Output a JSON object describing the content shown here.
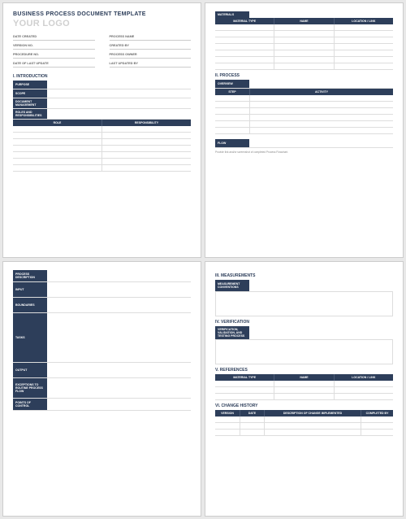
{
  "title": "BUSINESS PROCESS DOCUMENT TEMPLATE",
  "logo": "YOUR LOGO",
  "meta": {
    "date_created": "DATE CREATED",
    "process_name": "PROCESS NAME",
    "version_no": "VERSION NO.",
    "created_by": "CREATED BY",
    "procedure_no": "PROCEDURE NO.",
    "process_owner": "PROCESS OWNER",
    "date_last_update": "DATE OF LAST UPDATE",
    "last_updated_by": "LAST UPDATED BY"
  },
  "sections": {
    "introduction": "I.  INTRODUCTION",
    "process": "II.  PROCESS",
    "measurements": "III.  MEASUREMENTS",
    "verification": "IV.  VERIFICATION",
    "references": "V.  REFERENCES",
    "change_history": "VI.  CHANGE HISTORY"
  },
  "labels": {
    "purpose": "PURPOSE",
    "scope": "SCOPE",
    "doc_mgmt": "DOCUMENT MANAGEMENT",
    "roles_resp": "ROLES AND RESPONSIBILITIES",
    "role": "ROLE",
    "responsibility": "RESPONSIBILITY",
    "materials": "MATERIALS",
    "material_type": "MATERIAL TYPE",
    "name": "NAME",
    "location_link": "LOCATION / LINK",
    "overview": "OVERVIEW",
    "step": "STEP",
    "activity": "ACTIVITY",
    "flow": "FLOW",
    "process_desc": "PROCESS DESCRIPTION",
    "input": "INPUT",
    "boundaries": "BOUNDARIES",
    "tasks": "TASKS",
    "output": "OUTPUT",
    "exceptions": "EXCEPTIONS TO ROUTINE PROCESS FLOW",
    "control": "POINTS OF CONTROL",
    "meas_conv": "MEASUREMENT CONVENTIONS",
    "verif_process": "VERIFICATION, VALIDATION, AND TESTING PROCESS",
    "version": "VERSION",
    "date": "DATE",
    "desc_change": "DESCRIPTION OF CHANGE IMPLEMENTED",
    "completed_by": "COMPLETED BY"
  },
  "note": "Provide link and/or screenshot of completed Process Flowchart."
}
